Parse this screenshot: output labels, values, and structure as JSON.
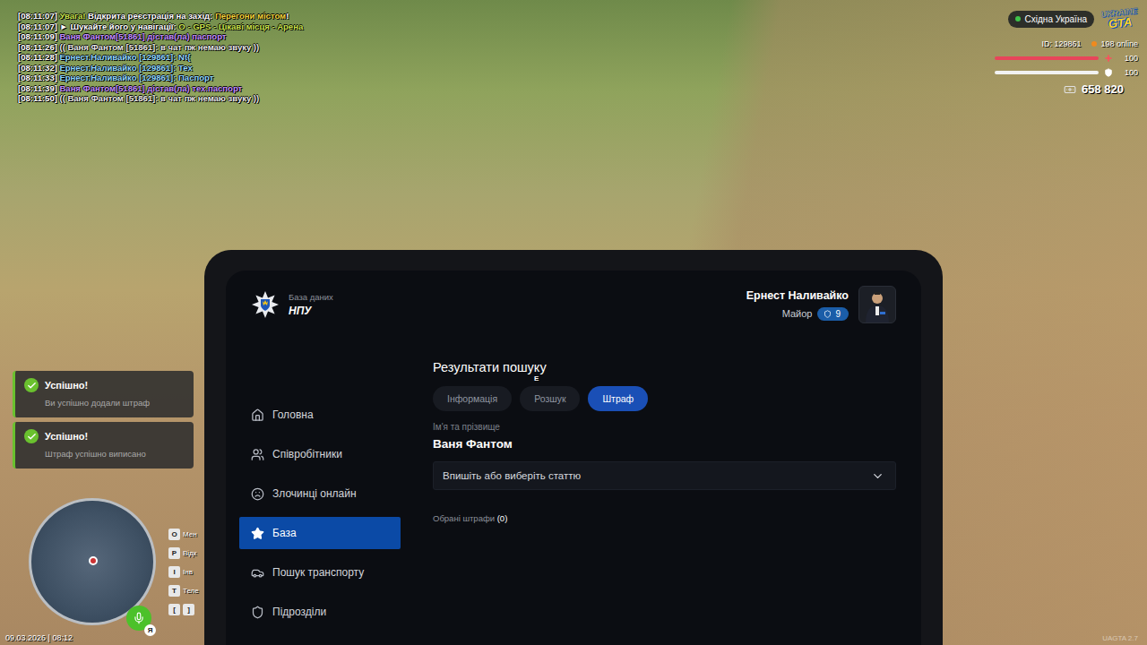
{
  "chat": [
    {
      "parts": [
        {
          "text": "[08:11:07] ",
          "color": "#ffffff"
        },
        {
          "text": "Увага!",
          "color": "#c9e24c"
        },
        {
          "text": " Відкрита реєстрація на захід: ",
          "color": "#ffffff"
        },
        {
          "text": "Перегони містом",
          "color": "#f2d23a"
        },
        {
          "text": "!",
          "color": "#ffffff"
        }
      ]
    },
    {
      "parts": [
        {
          "text": "[08:11:07] ",
          "color": "#ffffff"
        },
        {
          "text": "► Шукайте його у навігації: ",
          "color": "#ffffff"
        },
        {
          "text": "O - GPS - Цікаві місця - Арена",
          "color": "#c9e24c"
        }
      ]
    },
    {
      "parts": [
        {
          "text": "[08:11:09] ",
          "color": "#ffffff"
        },
        {
          "text": "Ваня Фантом[51861] дістав(ла) паспорт",
          "color": "#c38cff"
        }
      ]
    },
    {
      "parts": [
        {
          "text": "[08:11:26] ",
          "color": "#ffffff"
        },
        {
          "text": "(( Ваня Фантом [51861]: в чат пж немаю звуку ))",
          "color": "#e8e8e8"
        }
      ]
    },
    {
      "parts": [
        {
          "text": "[08:11:28] ",
          "color": "#ffffff"
        },
        {
          "text": "Ернест.Наливайко [129861]: Nt{",
          "color": "#8fd6ff"
        }
      ]
    },
    {
      "parts": [
        {
          "text": "[08:11:32] ",
          "color": "#ffffff"
        },
        {
          "text": "Ернест.Наливайко [129861]: Тех",
          "color": "#8fd6ff"
        }
      ]
    },
    {
      "parts": [
        {
          "text": "[08:11:33] ",
          "color": "#ffffff"
        },
        {
          "text": "Ернест.Наливайко [129861]: Паспорт",
          "color": "#8fd6ff"
        }
      ]
    },
    {
      "parts": [
        {
          "text": "[08:11:39] ",
          "color": "#ffffff"
        },
        {
          "text": "Ваня Фантом[51861] дістав(ла) тех.паспорт",
          "color": "#c38cff"
        }
      ]
    },
    {
      "parts": [
        {
          "text": "[08:11:50] ",
          "color": "#ffffff"
        },
        {
          "text": "(( Ваня Фантом [51861]: в чат пж немаю звуку ))",
          "color": "#e8e8e8"
        }
      ]
    }
  ],
  "hud": {
    "region": "Східна Україна",
    "logo": [
      "UKRAINE",
      "GTA"
    ],
    "player_id": "ID: 129861",
    "online": "198 online",
    "health": {
      "value": "100",
      "level": 1
    },
    "armor": {
      "value": "100",
      "level": 1
    },
    "money": "658 820",
    "prompt": "E",
    "date": "09.03.2026 | 08:12",
    "version": "UAGTA 2.7",
    "mic_label": "Я"
  },
  "notifications": [
    {
      "title": "Успішно!",
      "message": "Ви успішно додали штраф"
    },
    {
      "title": "Успішно!",
      "message": "Штраф успішно виписано"
    }
  ],
  "key_hints": [
    {
      "keys": [
        "O"
      ],
      "label": "Мен"
    },
    {
      "keys": [
        "P"
      ],
      "label": "Відк"
    },
    {
      "keys": [
        "I"
      ],
      "label": "Інв"
    },
    {
      "keys": [
        "T"
      ],
      "label": "Теле"
    },
    {
      "keys": [
        "[",
        "]"
      ]
    }
  ],
  "tablet": {
    "app_caption": "База даних",
    "app_title": "НПУ",
    "user": {
      "name": "Ернест Наливайко",
      "rank": "Майор",
      "level": "9"
    },
    "sidebar": [
      {
        "label": "Головна",
        "selected": false
      },
      {
        "label": "Співробітники",
        "selected": false
      },
      {
        "label": "Злочинці онлайн",
        "selected": false
      },
      {
        "label": "База",
        "selected": true
      },
      {
        "label": "Пошук транспорту",
        "selected": false
      },
      {
        "label": "Підрозділи",
        "selected": false
      }
    ],
    "page_title": "Результати пошуку",
    "tabs": [
      {
        "label": "Інформація",
        "selected": false
      },
      {
        "label": "Розшук",
        "selected": false
      },
      {
        "label": "Штраф",
        "selected": true
      }
    ],
    "name_label": "Ім'я та прізвище",
    "name_value": "Ваня Фантом",
    "select_placeholder": "Впишіть або виберіть статтю",
    "chosen_label": "Обрані штрафи",
    "chosen_count": "(0)"
  }
}
